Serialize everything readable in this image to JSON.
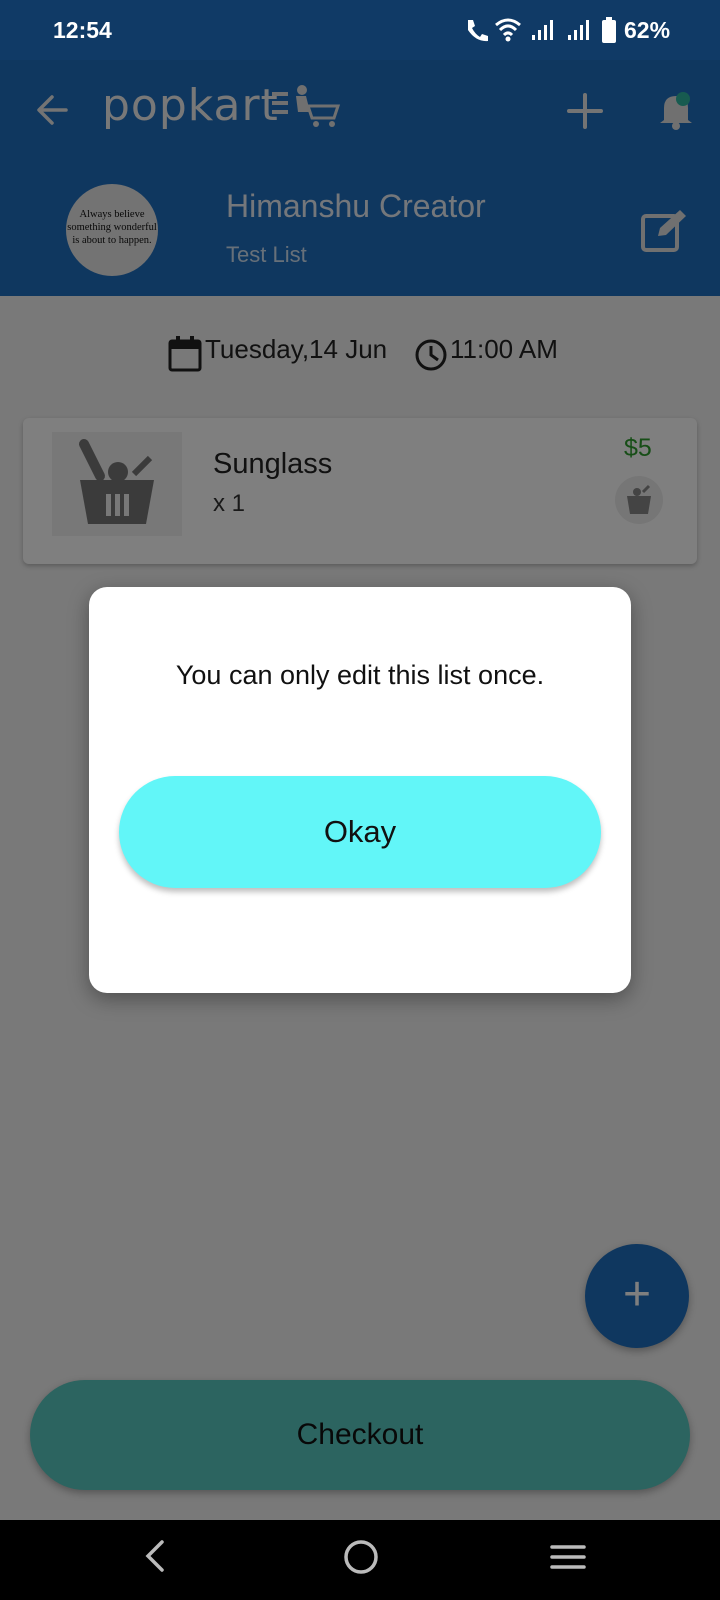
{
  "status_bar": {
    "time": "12:54",
    "battery": "62%",
    "icons": [
      "call-icon",
      "wifi-icon",
      "signal-1-icon",
      "signal-2-icon",
      "battery-icon"
    ]
  },
  "header": {
    "app_name": "popkart",
    "user_name": "Himanshu Creator",
    "list_name": "Test List",
    "avatar_quote": [
      "Always believe",
      "something wonderful",
      "is about to happen."
    ],
    "icons": [
      "back-arrow-icon",
      "add-icon",
      "bell-icon",
      "edit-icon"
    ],
    "accent": "#1f6fbf"
  },
  "schedule": {
    "date": "Tuesday,14 Jun",
    "time": "11:00 AM"
  },
  "items": [
    {
      "name": "Sunglass",
      "quantity": "x 1",
      "price": "$5"
    }
  ],
  "dialog": {
    "message": "You can only edit this list once.",
    "button_label": "Okay",
    "button_color": "#62f6f8"
  },
  "actions": {
    "fab_label": "+",
    "checkout_label": "Checkout",
    "checkout_color": "#58c8c0"
  }
}
